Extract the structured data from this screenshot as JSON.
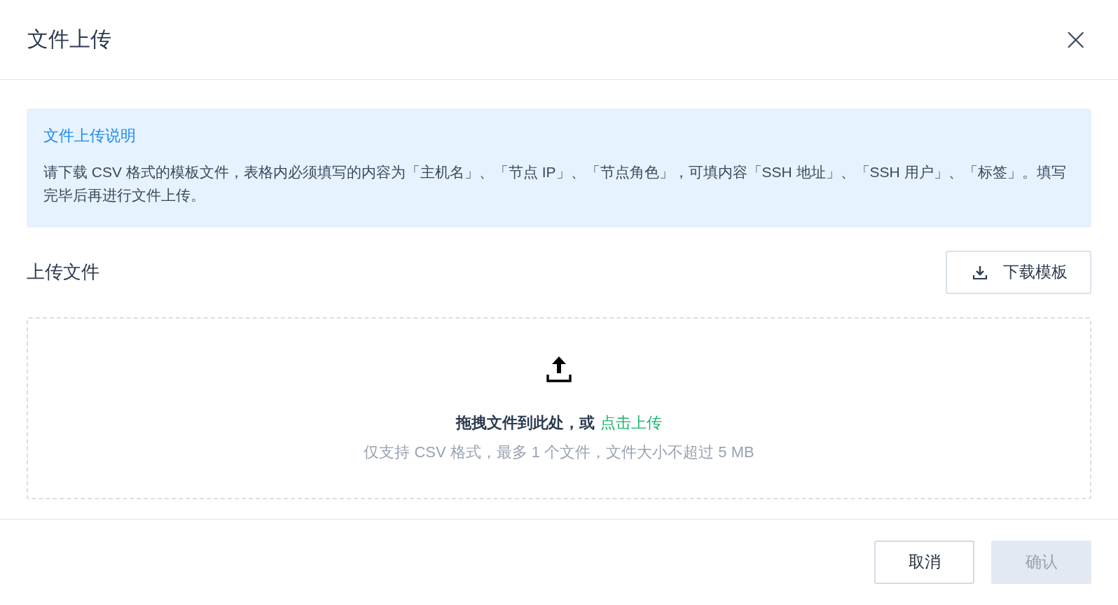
{
  "dialog": {
    "title": "文件上传",
    "close": "×"
  },
  "notice": {
    "title": "文件上传说明",
    "text": "请下载 CSV 格式的模板文件，表格内必须填写的内容为「主机名」、「节点 IP」、「节点角色」，可填内容「SSH 地址」、「SSH 用户」、「标签」。填写完毕后再进行文件上传。"
  },
  "section": {
    "title": "上传文件",
    "download_button": "下载模板"
  },
  "dropzone": {
    "prompt": "拖拽文件到此处，或",
    "link": "点击上传",
    "hint": "仅支持 CSV 格式，最多 1 个文件，文件大小不超过 5 MB"
  },
  "footer": {
    "buttons": [
      {
        "label": "取消",
        "disabled": false
      },
      {
        "label": "确认",
        "disabled": true
      }
    ]
  }
}
